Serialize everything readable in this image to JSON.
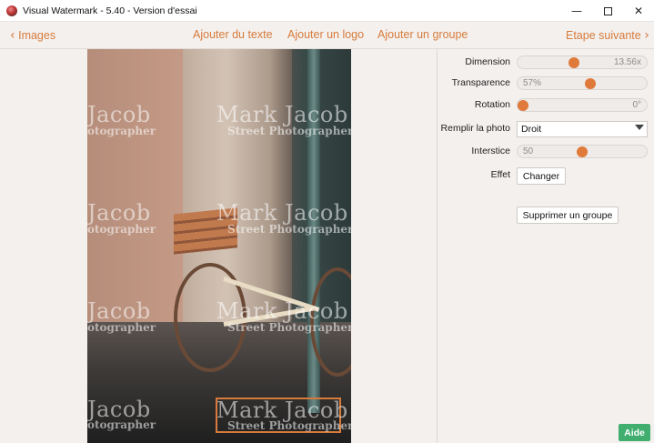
{
  "window": {
    "title": "Visual Watermark - 5.40 - Version d'essai",
    "minimize": "—",
    "close": "✕"
  },
  "toolbar": {
    "back_label": "Images",
    "add_text": "Ajouter du texte",
    "add_logo": "Ajouter un logo",
    "add_group": "Ajouter un groupe",
    "next_label": "Etape suivante"
  },
  "watermark": {
    "name": "Mark Jacob",
    "subtitle": "Street Photographer",
    "partial_name": "Jacob",
    "partial_subtitle": "otographer"
  },
  "panel": {
    "dimension": {
      "label": "Dimension",
      "value": "13.56x",
      "level": 0.43
    },
    "transparence": {
      "label": "Transparence",
      "value": "57%",
      "level": 0.57
    },
    "rotation": {
      "label": "Rotation",
      "value": "0°",
      "level": 0.0
    },
    "remplir": {
      "label": "Remplir la photo",
      "value": "Droit"
    },
    "interstice": {
      "label": "Interstice",
      "value": "50",
      "level": 0.5
    },
    "effet": {
      "label": "Effet",
      "button": "Changer"
    },
    "delete_group": "Supprimer un groupe"
  },
  "help_button": "Aide",
  "colors": {
    "accent": "#d77b3c",
    "knob": "#e07a3a",
    "help": "#3fae6f"
  }
}
